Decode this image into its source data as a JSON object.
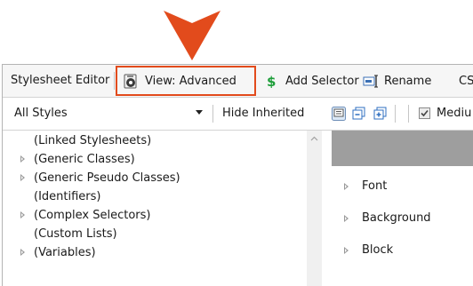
{
  "toolbar": {
    "title": "Stylesheet Editor",
    "view_label": "View: Advanced",
    "add_selector_label": "Add Selector",
    "rename_label": "Rename",
    "css_label": "CS"
  },
  "filter": {
    "styles_selected": "All Styles",
    "hide_inherited_label": "Hide Inherited",
    "medium_label": "Mediu"
  },
  "tree": {
    "items": [
      {
        "label": "(Linked Stylesheets)",
        "expandable": false
      },
      {
        "label": "(Generic Classes)",
        "expandable": true
      },
      {
        "label": "(Generic Pseudo Classes)",
        "expandable": true
      },
      {
        "label": "(Identifiers)",
        "expandable": false
      },
      {
        "label": "(Complex Selectors)",
        "expandable": true
      },
      {
        "label": "(Custom Lists)",
        "expandable": false
      },
      {
        "label": "(Variables)",
        "expandable": true
      }
    ]
  },
  "properties": {
    "groups": [
      "Font",
      "Background",
      "Block"
    ]
  },
  "colors": {
    "callout": "#e24b1c",
    "highlight_border": "#e24b1c",
    "panel_header": "#9e9e9e"
  }
}
